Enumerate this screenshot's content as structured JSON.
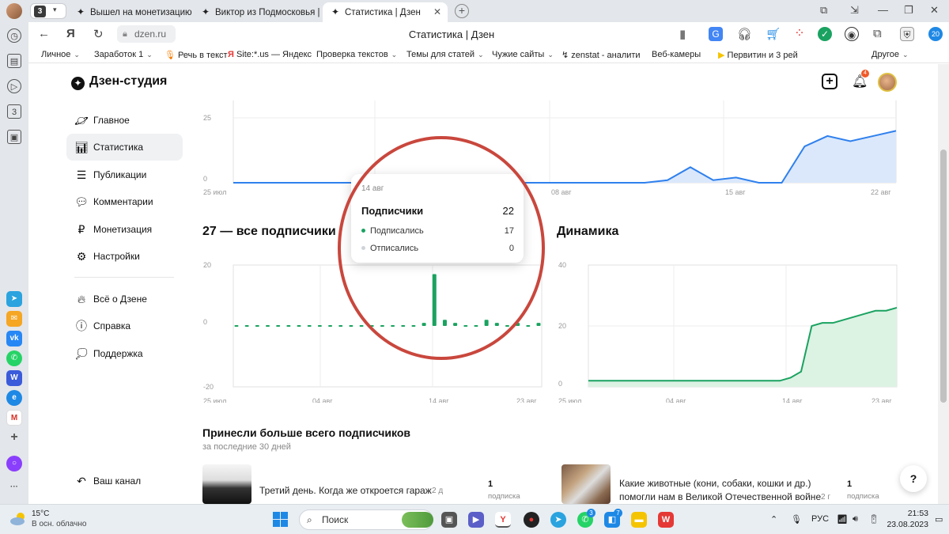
{
  "browser": {
    "tab_counter": "3",
    "tabs": [
      {
        "title": "Вышел на монетизацию з",
        "active": false
      },
      {
        "title": "Виктор из Подмосковья |",
        "active": false
      },
      {
        "title": "Статистика | Дзен",
        "active": true
      }
    ],
    "url": "dzen.ru",
    "page_title": "Статистика | Дзен",
    "bookmarks": [
      "Личное",
      "Заработок 1",
      "Речь в текст",
      "Site:*.us — Яндекс",
      "Проверка текстов",
      "Темы для статей",
      "Чужие сайты",
      "zenstat - аналити",
      "Веб-камеры",
      "Первитин и 3 рей",
      "Другое"
    ],
    "download_badge": "20"
  },
  "header": {
    "logo": "Дзен-студия",
    "notification_count": "4"
  },
  "sidebar": {
    "items": [
      {
        "label": "Главное",
        "icon": "planet-icon"
      },
      {
        "label": "Статистика",
        "icon": "bar-chart-icon",
        "active": true
      },
      {
        "label": "Публикации",
        "icon": "stack-icon"
      },
      {
        "label": "Комментарии",
        "icon": "comment-icon"
      },
      {
        "label": "Монетизация",
        "icon": "ruble-icon"
      },
      {
        "label": "Настройки",
        "icon": "gear-icon"
      }
    ],
    "secondary": [
      {
        "label": "Всё о Дзене",
        "icon": "flame-icon"
      },
      {
        "label": "Справка",
        "icon": "help-icon"
      },
      {
        "label": "Поддержка",
        "icon": "chat-icon"
      }
    ],
    "footer": {
      "label": "Ваш канал",
      "icon": "back-arrow-icon"
    }
  },
  "top_chart": {
    "y_ticks": [
      "25",
      "0"
    ],
    "x_ticks": [
      "25 июл",
      "14 авг",
      "08 авг",
      "15 авг",
      "22 авг"
    ]
  },
  "subs_chart": {
    "title": "27 — все подписчики",
    "y_ticks": [
      "20",
      "0",
      "-20"
    ],
    "x_ticks": [
      "25 июл",
      "04 авг",
      "14 авг",
      "23 авг"
    ]
  },
  "dynamics_chart": {
    "title": "Динамика",
    "y_ticks": [
      "40",
      "20",
      "0"
    ],
    "x_ticks": [
      "25 июл",
      "04 авг",
      "14 авг",
      "23 авг"
    ]
  },
  "chart_data": [
    {
      "type": "area",
      "ylim": [
        0,
        25
      ],
      "x": [
        "25 июл",
        "26 июл",
        "27 июл",
        "28 июл",
        "29 июл",
        "30 июл",
        "31 июл",
        "01 авг",
        "02 авг",
        "03 авг",
        "04 авг",
        "05 авг",
        "06 авг",
        "07 авг",
        "08 авг",
        "09 авг",
        "10 авг",
        "11 авг",
        "12 авг",
        "13 авг",
        "14 авг",
        "15 авг",
        "16 авг",
        "17 авг",
        "18 авг",
        "19 авг",
        "20 авг",
        "21 авг",
        "22 авг",
        "23 авг"
      ],
      "values": [
        0,
        0,
        0,
        0,
        0,
        0,
        0,
        0,
        0,
        0,
        0,
        0,
        0,
        0,
        0,
        0,
        0,
        0,
        0,
        1,
        6,
        1,
        2,
        0,
        0,
        14,
        18,
        16,
        18,
        20
      ],
      "color": "#2f80ed"
    },
    {
      "type": "bar",
      "title": "27 — все подписчики",
      "ylim": [
        -20,
        20
      ],
      "series": [
        {
          "name": "Подписались",
          "color": "#1aa260",
          "values": [
            0,
            0,
            0,
            0,
            0,
            0,
            0,
            0,
            0,
            0,
            0,
            0,
            0,
            0,
            0,
            0,
            0,
            0,
            1,
            17,
            2,
            1,
            0,
            0,
            2,
            1,
            0,
            1,
            0,
            1
          ]
        },
        {
          "name": "Отписались",
          "color": "#cfd4da",
          "values": [
            0,
            0,
            0,
            0,
            0,
            0,
            0,
            0,
            0,
            0,
            0,
            0,
            0,
            0,
            0,
            0,
            0,
            0,
            0,
            0,
            0,
            0,
            0,
            0,
            0,
            0,
            0,
            0,
            0,
            0
          ]
        }
      ]
    },
    {
      "type": "area",
      "title": "Динамика",
      "ylim": [
        0,
        40
      ],
      "values": [
        2,
        2,
        2,
        2,
        2,
        2,
        2,
        2,
        2,
        2,
        2,
        2,
        2,
        2,
        2,
        2,
        2,
        2,
        2,
        3,
        5,
        20,
        21,
        21,
        22,
        23,
        24,
        25,
        25,
        26
      ],
      "color": "#1aa260"
    }
  ],
  "tooltip": {
    "date": "14 авг",
    "title": "Подписчики",
    "total": "22",
    "rows": [
      {
        "label": "Подписались",
        "value": "17",
        "color": "#1aa260"
      },
      {
        "label": "Отписались",
        "value": "0",
        "color": "#cfd4da"
      }
    ]
  },
  "top_publications": {
    "title": "Принесли больше всего подписчиков",
    "subtitle": "за последние 30 дней",
    "items": [
      {
        "title": "Третий день. Когда же откроется гараж",
        "age": "2 д",
        "count": "1",
        "unit": "подписка"
      },
      {
        "title_line1": "Какие животные (кони, собаки, кошки и др.)",
        "title_line2": "помогли нам в Великой Отечественной войне",
        "age": "2 г",
        "count": "1",
        "unit": "подписка"
      }
    ]
  },
  "help_button": "?",
  "taskbar": {
    "temperature": "15°C",
    "weather": "В осн. облачно",
    "search": "Поиск",
    "lang": "РУС",
    "time": "21:53",
    "date": "23.08.2023",
    "telegram_badge": "3",
    "app_badge": "7"
  }
}
